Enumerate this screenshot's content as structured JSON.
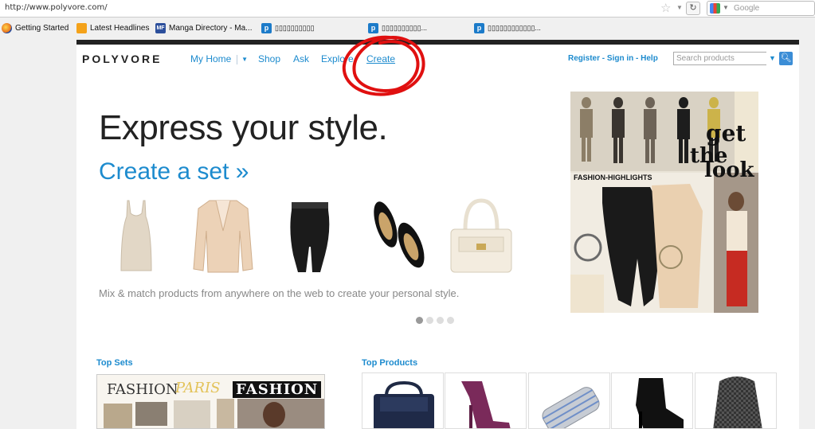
{
  "browser": {
    "url": "http://www.polyvore.com/",
    "search_engine": "Google",
    "bookmarks": [
      {
        "label": "Getting Started",
        "icon": "firefox-icon"
      },
      {
        "label": "Latest Headlines",
        "icon": "rss-icon"
      },
      {
        "label": "Manga Directory - Ma...",
        "icon": "mangafox-icon",
        "badge": "MF"
      },
      {
        "label": "▯▯▯▯▯▯▯▯▯▯",
        "icon": "polyvore-icon",
        "badge": "p"
      },
      {
        "label": "▯▯▯▯▯▯▯▯▯▯...",
        "icon": "polyvore-icon",
        "badge": "p"
      },
      {
        "label": "▯▯▯▯▯▯▯▯▯▯▯▯...",
        "icon": "polyvore-icon",
        "badge": "p"
      }
    ]
  },
  "header": {
    "logo": "POLYVORE",
    "nav": {
      "my_home": "My Home",
      "shop": "Shop",
      "ask": "Ask",
      "explore": "Explore",
      "create": "Create"
    },
    "account": {
      "register": "Register",
      "sep1": " - ",
      "sign_in": "Sign in",
      "sep2": " - ",
      "help": "Help"
    },
    "search_placeholder": "Search products"
  },
  "hero": {
    "title": "Express your style.",
    "subtitle": "Create a set »",
    "description": "Mix & match products from anywhere on the web to create your personal style.",
    "carousel_total": 4,
    "carousel_active": 1
  },
  "collage_text": {
    "caption": "FASHION-HIGHLIGHTS",
    "get": "get",
    "the": "the",
    "look": "look"
  },
  "sections": {
    "top_sets": "Top Sets",
    "top_products": "Top Products",
    "set_word_1": "FASHION",
    "set_word_2": "PARIS",
    "set_word_3": "FASHION"
  },
  "colors": {
    "link_blue": "#1d8bce",
    "annotation_red": "#e01010"
  }
}
